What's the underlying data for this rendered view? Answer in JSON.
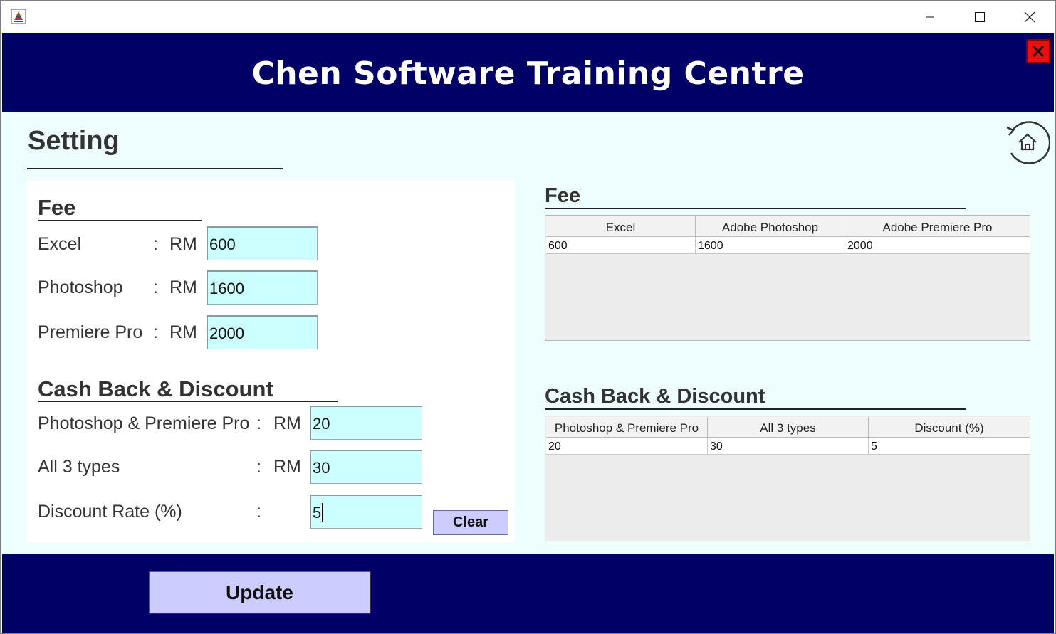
{
  "header": {
    "title": "Chen Software Training Centre"
  },
  "page": {
    "title": "Setting"
  },
  "form": {
    "fee": {
      "title": "Fee",
      "rows": [
        {
          "label": "Excel",
          "sep": ":",
          "currency": "RM",
          "value": "600"
        },
        {
          "label": "Photoshop",
          "sep": ":",
          "currency": "RM",
          "value": "1600"
        },
        {
          "label": "Premiere Pro",
          "sep": ":",
          "currency": "RM",
          "value": "2000"
        }
      ]
    },
    "cashback": {
      "title": "Cash Back & Discount",
      "rows": [
        {
          "label": "Photoshop & Premiere Pro",
          "sep": ":",
          "currency": "RM",
          "value": "20"
        },
        {
          "label": "All 3 types",
          "sep": ":",
          "currency": "RM",
          "value": "30"
        },
        {
          "label": "Discount Rate (%)",
          "sep": ":",
          "currency": "",
          "value": "5"
        }
      ]
    },
    "clear_label": "Clear"
  },
  "fee_table": {
    "title": "Fee",
    "columns": [
      "Excel",
      "Adobe Photoshop",
      "Adobe Premiere Pro"
    ],
    "rows": [
      [
        "600",
        "1600",
        "2000"
      ]
    ]
  },
  "cashback_table": {
    "title": "Cash Back & Discount",
    "columns": [
      "Photoshop & Premiere Pro",
      "All 3 types",
      "Discount (%)"
    ],
    "rows": [
      [
        "20",
        "30",
        "5"
      ]
    ]
  },
  "footer": {
    "update_label": "Update"
  },
  "icons": {
    "app": "java-cup-icon",
    "minimize": "minimize-icon",
    "maximize": "maximize-icon",
    "close": "close-icon",
    "exit": "red-x-icon",
    "home": "home-refresh-icon"
  },
  "colors": {
    "header_bg": "#000066",
    "content_bg": "#eefefe",
    "field_bg": "#ccffff",
    "button_bg": "#ccccff",
    "exit_red": "#e81010"
  }
}
